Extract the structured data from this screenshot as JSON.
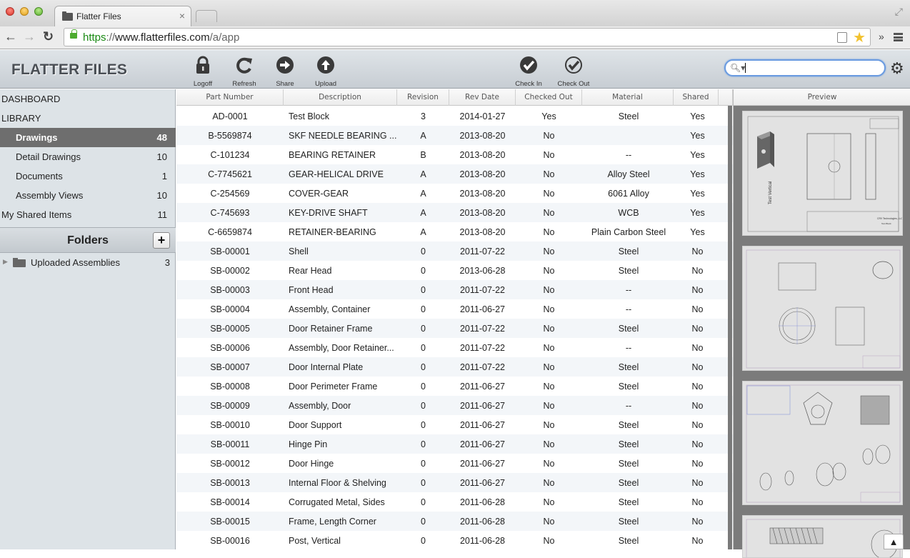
{
  "browser": {
    "tab_title": "Flatter Files",
    "url_scheme": "https",
    "url_sep": "://",
    "url_host": "www.flatterfiles.com",
    "url_path": "/a/app"
  },
  "header": {
    "brand": "FLATTER FILES",
    "tools": [
      {
        "label": "Logoff",
        "icon": "lock-icon"
      },
      {
        "label": "Refresh",
        "icon": "refresh-icon"
      },
      {
        "label": "Share",
        "icon": "share-icon"
      },
      {
        "label": "Upload",
        "icon": "upload-icon"
      },
      {
        "label": "Check In",
        "icon": "check-in-icon"
      },
      {
        "label": "Check Out",
        "icon": "check-out-icon"
      }
    ],
    "search_value": "",
    "search_placeholder": ""
  },
  "sidebar": {
    "dashboard": "DASHBOARD",
    "library": "LIBRARY",
    "items": [
      {
        "label": "Drawings",
        "count": "48",
        "active": true
      },
      {
        "label": "Detail Drawings",
        "count": "10"
      },
      {
        "label": "Documents",
        "count": "1"
      },
      {
        "label": "Assembly Views",
        "count": "10"
      }
    ],
    "shared": {
      "label": "My Shared Items",
      "count": "11"
    },
    "folders_title": "Folders",
    "add_label": "+",
    "folders": [
      {
        "label": "Uploaded Assemblies",
        "count": "3"
      }
    ]
  },
  "table": {
    "columns": [
      "Part Number",
      "Description",
      "Revision",
      "Rev Date",
      "Checked Out",
      "Material",
      "Shared"
    ],
    "rows": [
      [
        "AD-0001",
        "Test Block",
        "3",
        "2014-01-27",
        "Yes",
        "Steel",
        "Yes"
      ],
      [
        "B-5569874",
        "SKF NEEDLE BEARING ...",
        "A",
        "2013-08-20",
        "No",
        "",
        "Yes"
      ],
      [
        "C-101234",
        "BEARING RETAINER",
        "B",
        "2013-08-20",
        "No",
        "--",
        "Yes"
      ],
      [
        "C-7745621",
        "GEAR-HELICAL DRIVE",
        "A",
        "2013-08-20",
        "No",
        "Alloy Steel",
        "Yes"
      ],
      [
        "C-254569",
        "COVER-GEAR",
        "A",
        "2013-08-20",
        "No",
        "6061 Alloy",
        "Yes"
      ],
      [
        "C-745693",
        "KEY-DRIVE SHAFT",
        "A",
        "2013-08-20",
        "No",
        "WCB",
        "Yes"
      ],
      [
        "C-6659874",
        "RETAINER-BEARING",
        "A",
        "2013-08-20",
        "No",
        "Plain Carbon Steel",
        "Yes"
      ],
      [
        "SB-00001",
        "Shell",
        "0",
        "2011-07-22",
        "No",
        "Steel",
        "No"
      ],
      [
        "SB-00002",
        "Rear Head",
        "0",
        "2013-06-28",
        "No",
        "Steel",
        "No"
      ],
      [
        "SB-00003",
        "Front Head",
        "0",
        "2011-07-22",
        "No",
        "--",
        "No"
      ],
      [
        "SB-00004",
        "Assembly, Container",
        "0",
        "2011-06-27",
        "No",
        "--",
        "No"
      ],
      [
        "SB-00005",
        "Door Retainer Frame",
        "0",
        "2011-07-22",
        "No",
        "Steel",
        "No"
      ],
      [
        "SB-00006",
        "Assembly, Door Retainer...",
        "0",
        "2011-07-22",
        "No",
        "--",
        "No"
      ],
      [
        "SB-00007",
        "Door Internal Plate",
        "0",
        "2011-07-22",
        "No",
        "Steel",
        "No"
      ],
      [
        "SB-00008",
        "Door Perimeter Frame",
        "0",
        "2011-06-27",
        "No",
        "Steel",
        "No"
      ],
      [
        "SB-00009",
        "Assembly, Door",
        "0",
        "2011-06-27",
        "No",
        "--",
        "No"
      ],
      [
        "SB-00010",
        "Door Support",
        "0",
        "2011-06-27",
        "No",
        "Steel",
        "No"
      ],
      [
        "SB-00011",
        "Hinge Pin",
        "0",
        "2011-06-27",
        "No",
        "Steel",
        "No"
      ],
      [
        "SB-00012",
        "Door Hinge",
        "0",
        "2011-06-27",
        "No",
        "Steel",
        "No"
      ],
      [
        "SB-00013",
        "Internal Floor & Shelving",
        "0",
        "2011-06-27",
        "No",
        "Steel",
        "No"
      ],
      [
        "SB-00014",
        "Corrugated Metal, Sides",
        "0",
        "2011-06-28",
        "No",
        "Steel",
        "No"
      ],
      [
        "SB-00015",
        "Frame, Length Corner",
        "0",
        "2011-06-28",
        "No",
        "Steel",
        "No"
      ],
      [
        "SB-00016",
        "Post, Vertical",
        "0",
        "2011-06-28",
        "No",
        "Steel",
        "No"
      ]
    ]
  },
  "preview": {
    "title": "Preview",
    "thumb1_label": "Test Vertical",
    "thumb1_company": "CRV Technologies, LLC",
    "thumb1_part": "Test Block",
    "scroll_top": "▲"
  }
}
